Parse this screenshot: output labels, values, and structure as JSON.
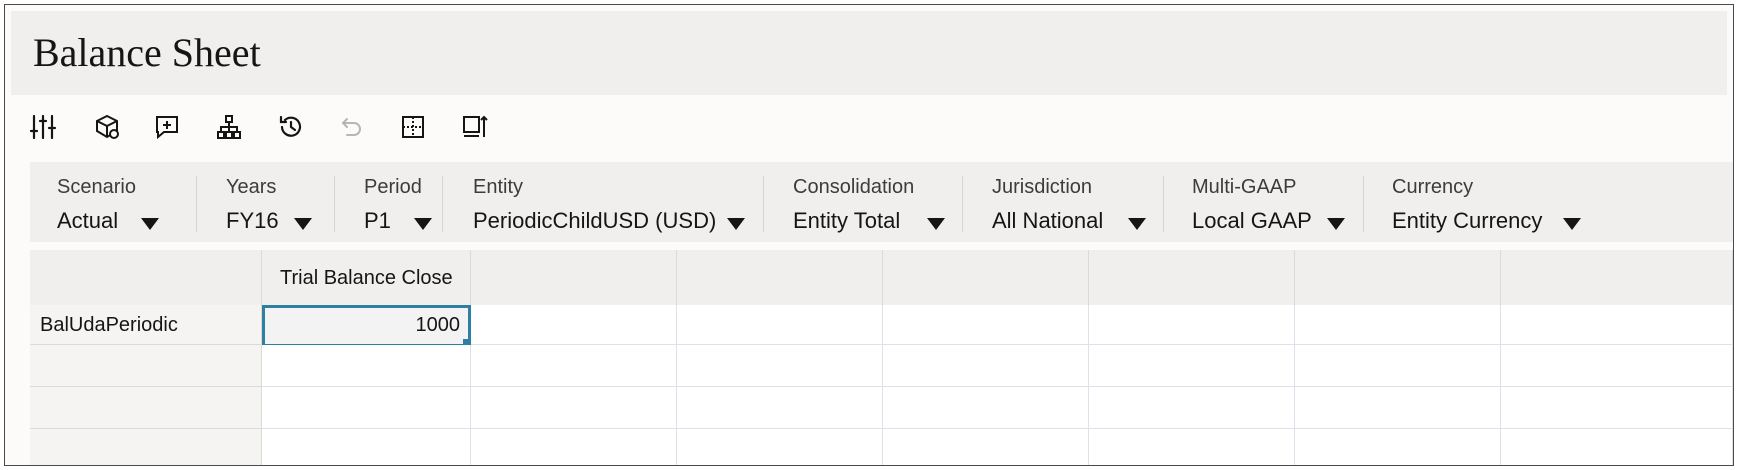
{
  "page": {
    "title": "Balance Sheet"
  },
  "toolbar": [
    {
      "name": "adjust-sliders-icon",
      "enabled": true
    },
    {
      "name": "cube-refresh-icon",
      "enabled": true
    },
    {
      "name": "add-comment-icon",
      "enabled": true
    },
    {
      "name": "hierarchy-icon",
      "enabled": true
    },
    {
      "name": "history-icon",
      "enabled": true
    },
    {
      "name": "undo-icon",
      "enabled": false
    },
    {
      "name": "grid-select-icon",
      "enabled": true
    },
    {
      "name": "sort-export-icon",
      "enabled": true
    }
  ],
  "pov": [
    {
      "label": "Scenario",
      "value": "Actual"
    },
    {
      "label": "Years",
      "value": "FY16"
    },
    {
      "label": "Period",
      "value": "P1"
    },
    {
      "label": "Entity",
      "value": "PeriodicChildUSD (USD)"
    },
    {
      "label": "Consolidation",
      "value": "Entity Total"
    },
    {
      "label": "Jurisdiction",
      "value": "All National"
    },
    {
      "label": "Multi-GAAP",
      "value": "Local GAAP"
    },
    {
      "label": "Currency",
      "value": "Entity Currency"
    }
  ],
  "grid": {
    "column_headers": [
      "Trial Balance Close",
      "",
      "",
      "",
      "",
      "",
      ""
    ],
    "rows": [
      {
        "label": "BalUdaPeriodic",
        "cells": [
          "1000",
          "",
          "",
          "",
          "",
          "",
          ""
        ]
      },
      {
        "label": "",
        "cells": [
          "",
          "",
          "",
          "",
          "",
          "",
          ""
        ]
      },
      {
        "label": "",
        "cells": [
          "",
          "",
          "",
          "",
          "",
          "",
          ""
        ]
      }
    ],
    "selected_cell": "BalUdaPeriodic / Trial Balance Close"
  },
  "colors": {
    "selection_border": "#2f7fa3",
    "header_bg": "#f1efed",
    "title_bar_bg": "#f1efed"
  }
}
